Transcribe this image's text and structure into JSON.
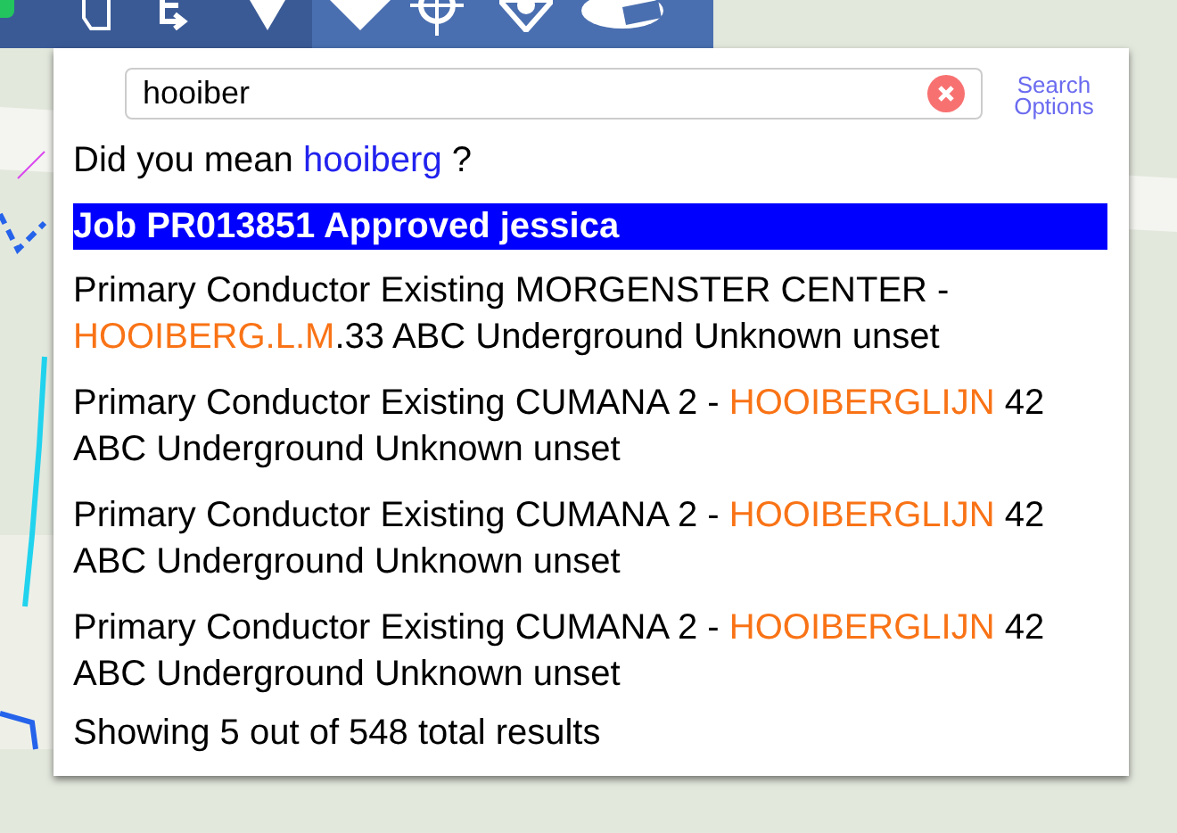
{
  "search": {
    "value": "hooiber",
    "options_link": "Search Options"
  },
  "suggestion": {
    "prefix": "Did you mean",
    "term": "hooiberg",
    "suffix": "?"
  },
  "results": [
    {
      "selected": true,
      "segments": [
        {
          "text": "Job PR013851 Approved jessica",
          "highlight": false
        }
      ]
    },
    {
      "selected": false,
      "segments": [
        {
          "text": "Primary Conductor Existing MORGENSTER CENTER - ",
          "highlight": false
        },
        {
          "text": "HOOIBERG.L.M",
          "highlight": true
        },
        {
          "text": ".33 ABC Underground Unknown unset",
          "highlight": false
        }
      ]
    },
    {
      "selected": false,
      "segments": [
        {
          "text": "Primary Conductor Existing CUMANA 2 - ",
          "highlight": false
        },
        {
          "text": "HOOIBERGLIJN",
          "highlight": true
        },
        {
          "text": " 42 ABC Underground Unknown unset",
          "highlight": false
        }
      ]
    },
    {
      "selected": false,
      "segments": [
        {
          "text": "Primary Conductor Existing CUMANA 2 - ",
          "highlight": false
        },
        {
          "text": "HOOIBERGLIJN",
          "highlight": true
        },
        {
          "text": " 42 ABC Underground Unknown unset",
          "highlight": false
        }
      ]
    },
    {
      "selected": false,
      "segments": [
        {
          "text": "Primary Conductor Existing CUMANA 2 - ",
          "highlight": false
        },
        {
          "text": "HOOIBERGLIJN",
          "highlight": true
        },
        {
          "text": " 42 ABC Underground Unknown unset",
          "highlight": false
        }
      ]
    }
  ],
  "summary": "Showing 5 out of 548 total results"
}
